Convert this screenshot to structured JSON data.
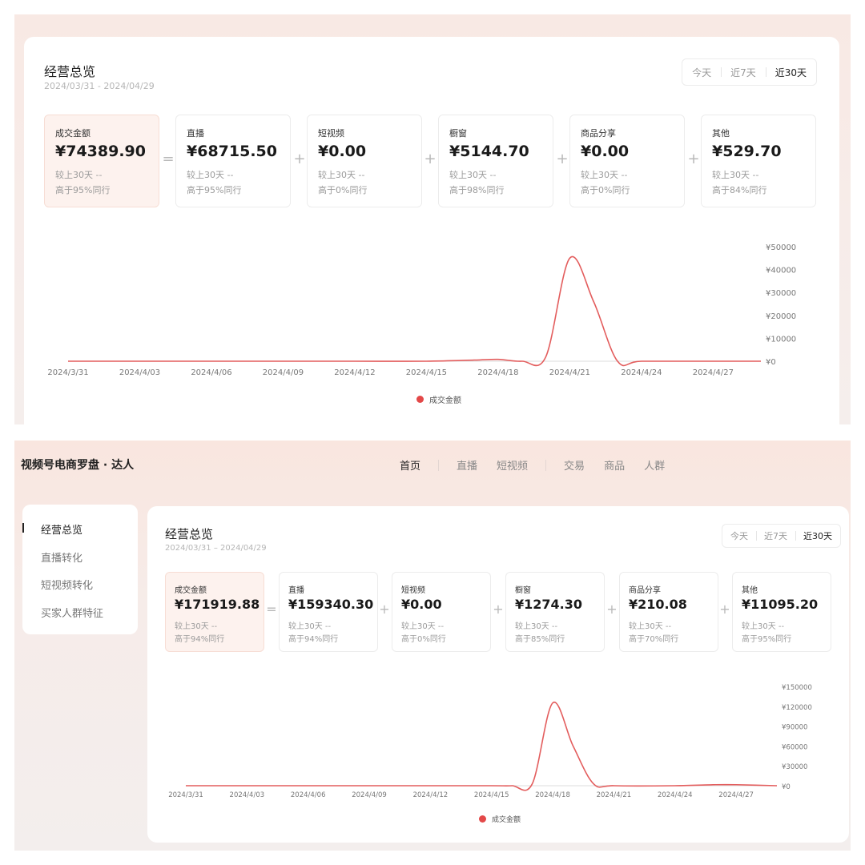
{
  "top_panel": {
    "title": "经营总览",
    "date_range": "2024/03/31 - 2024/04/29",
    "range_tabs": [
      "今天",
      "近7天",
      "近30天"
    ],
    "active_range": "近30天",
    "metrics": [
      {
        "label": "成交金额",
        "value": "¥74389.90",
        "compare": "较上30天 --",
        "percentile": "高于95%同行",
        "highlight": true
      },
      {
        "label": "直播",
        "value": "¥68715.50",
        "compare": "较上30天 --",
        "percentile": "高于95%同行"
      },
      {
        "label": "短视频",
        "value": "¥0.00",
        "compare": "较上30天 --",
        "percentile": "高于0%同行"
      },
      {
        "label": "橱窗",
        "value": "¥5144.70",
        "compare": "较上30天 --",
        "percentile": "高于98%同行"
      },
      {
        "label": "商品分享",
        "value": "¥0.00",
        "compare": "较上30天 --",
        "percentile": "高于0%同行"
      },
      {
        "label": "其他",
        "value": "¥529.70",
        "compare": "较上30天 --",
        "percentile": "高于84%同行"
      }
    ],
    "operators": [
      "=",
      "+",
      "+",
      "+",
      "+"
    ]
  },
  "bottom_panel": {
    "app_name": "视频号电商罗盘 · 达人",
    "nav": [
      "首页",
      "直播",
      "短视频",
      "交易",
      "商品",
      "人群"
    ],
    "active_nav": "首页",
    "sidebar": [
      "经营总览",
      "直播转化",
      "短视频转化",
      "买家人群特征"
    ],
    "active_sidebar": "经营总览",
    "title": "经营总览",
    "date_range": "2024/03/31 – 2024/04/29",
    "range_tabs": [
      "今天",
      "近7天",
      "近30天"
    ],
    "active_range": "近30天",
    "metrics": [
      {
        "label": "成交金额",
        "value": "¥171919.88",
        "compare": "较上30天 --",
        "percentile": "高于94%同行",
        "highlight": true
      },
      {
        "label": "直播",
        "value": "¥159340.30",
        "compare": "较上30天 --",
        "percentile": "高于94%同行"
      },
      {
        "label": "短视频",
        "value": "¥0.00",
        "compare": "较上30天 --",
        "percentile": "高于0%同行"
      },
      {
        "label": "橱窗",
        "value": "¥1274.30",
        "compare": "较上30天 --",
        "percentile": "高于85%同行"
      },
      {
        "label": "商品分享",
        "value": "¥210.08",
        "compare": "较上30天 --",
        "percentile": "高于70%同行"
      },
      {
        "label": "其他",
        "value": "¥11095.20",
        "compare": "较上30天 --",
        "percentile": "高于95%同行"
      }
    ],
    "operators": [
      "=",
      "+",
      "+",
      "+",
      "+"
    ]
  },
  "colors": {
    "line": "#e35d5d",
    "legend_dot": "#e34848",
    "axis": "#dddddd",
    "tick_text": "#777777"
  },
  "chart_data": [
    {
      "type": "line",
      "series": [
        {
          "name": "成交金额",
          "x": [
            "2024/3/31",
            "2024/4/03",
            "2024/4/06",
            "2024/4/09",
            "2024/4/12",
            "2024/4/15",
            "2024/4/17",
            "2024/4/18",
            "2024/4/19",
            "2024/4/20",
            "2024/4/21",
            "2024/4/22",
            "2024/4/23",
            "2024/4/24",
            "2024/4/27",
            "2024/4/29"
          ],
          "values": [
            0,
            0,
            0,
            0,
            0,
            0,
            500,
            800,
            0,
            2000,
            45000,
            26000,
            0,
            0,
            0,
            0
          ]
        }
      ],
      "x_ticks": [
        "2024/3/31",
        "2024/4/03",
        "2024/4/06",
        "2024/4/09",
        "2024/4/12",
        "2024/4/15",
        "2024/4/18",
        "2024/4/21",
        "2024/4/24",
        "2024/4/27"
      ],
      "y_ticks": [
        "¥0",
        "¥10000",
        "¥20000",
        "¥30000",
        "¥40000",
        "¥50000"
      ],
      "ylim": [
        0,
        50000
      ],
      "legend": "成交金额"
    },
    {
      "type": "line",
      "series": [
        {
          "name": "成交金额",
          "x": [
            "2024/3/31",
            "2024/4/03",
            "2024/4/06",
            "2024/4/09",
            "2024/4/12",
            "2024/4/15",
            "2024/4/16",
            "2024/4/17",
            "2024/4/18",
            "2024/4/19",
            "2024/4/20",
            "2024/4/21",
            "2024/4/24",
            "2024/4/26",
            "2024/4/27",
            "2024/4/29"
          ],
          "values": [
            0,
            0,
            0,
            0,
            0,
            0,
            0,
            3000,
            125000,
            60000,
            3000,
            0,
            0,
            1500,
            1500,
            0
          ]
        }
      ],
      "x_ticks": [
        "2024/3/31",
        "2024/4/03",
        "2024/4/06",
        "2024/4/09",
        "2024/4/12",
        "2024/4/15",
        "2024/4/18",
        "2024/4/21",
        "2024/4/24",
        "2024/4/27"
      ],
      "y_ticks": [
        "¥0",
        "¥30000",
        "¥60000",
        "¥90000",
        "¥120000",
        "¥150000"
      ],
      "ylim": [
        0,
        150000
      ],
      "legend": "成交金额"
    }
  ]
}
